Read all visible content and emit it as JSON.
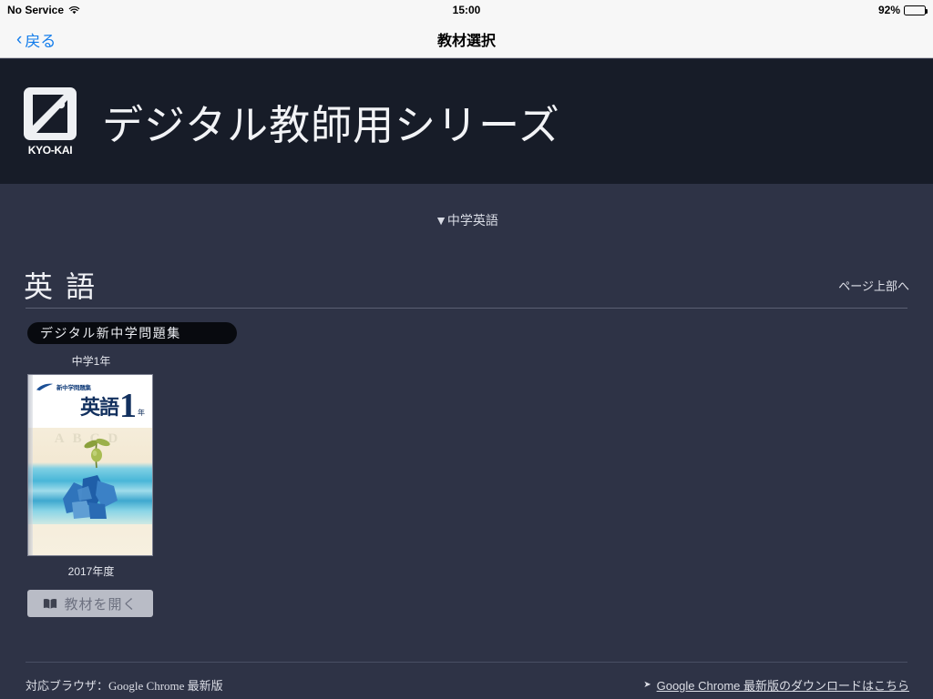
{
  "status_bar": {
    "carrier": "No Service",
    "wifi_icon": "wifi-icon",
    "time": "15:00",
    "battery_percent": "92%",
    "battery_icon": "battery-icon"
  },
  "nav_bar": {
    "back_chevron": "‹",
    "back_label": "戻る",
    "title": "教材選択"
  },
  "header": {
    "logo_text": "KYO-KAI",
    "logo_icon": "kyokai-logo-icon",
    "site_title": "デジタル教師用シリーズ"
  },
  "main": {
    "category_selector": "▼中学英語",
    "subject_heading": "英語",
    "page_top_link": "ページ上部へ",
    "series_badge": "デジタル新中学問題集",
    "book": {
      "grade_label": "中学1年",
      "year_label": "2017年度",
      "open_button_label": "教材を開く",
      "open_button_icon": "book-icon",
      "cover": {
        "publisher_logo_text": "新中学問題集",
        "subject": "英語",
        "number": "1",
        "number_suffix": "年",
        "decorative_letters": "ABCD"
      }
    }
  },
  "footer": {
    "browser_note": "対応ブラウザ：Google Chrome 最新版",
    "download_arrow": "➤",
    "download_link": "Google Chrome 最新版のダウンロードはこちら"
  },
  "colors": {
    "header_bg": "#171c28",
    "main_bg": "#2e3346",
    "status_bg": "#f7f7f7",
    "ios_blue": "#127ceb",
    "button_bg": "#b9bcc6",
    "badge_bg": "#080a0f"
  }
}
